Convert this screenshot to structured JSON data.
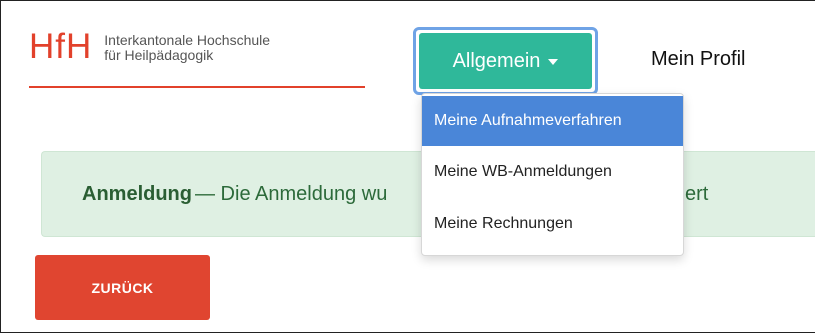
{
  "logo": {
    "mark": "HfH",
    "line1": "Interkantonale Hochschule",
    "line2": "für Heilpädagogik"
  },
  "nav": {
    "general_label": "Allgemein",
    "profile_label": "Mein Profil"
  },
  "dropdown": {
    "items": [
      {
        "label": "Meine Aufnahmeverfahren",
        "active": true
      },
      {
        "label": "Meine WB-Anmeldungen",
        "active": false
      },
      {
        "label": "Meine Rechnungen",
        "active": false
      }
    ]
  },
  "alert": {
    "title": "Anmeldung",
    "message_start": "— Die Anmeldung wu",
    "message_end": "ert"
  },
  "back_button": {
    "label": "ZURÜCK"
  },
  "colors": {
    "brand_red": "#e2412b",
    "nav_green": "#2fb89a",
    "dropdown_active": "#4a86d8",
    "alert_bg": "#dff0e3",
    "back_red": "#e04530"
  }
}
